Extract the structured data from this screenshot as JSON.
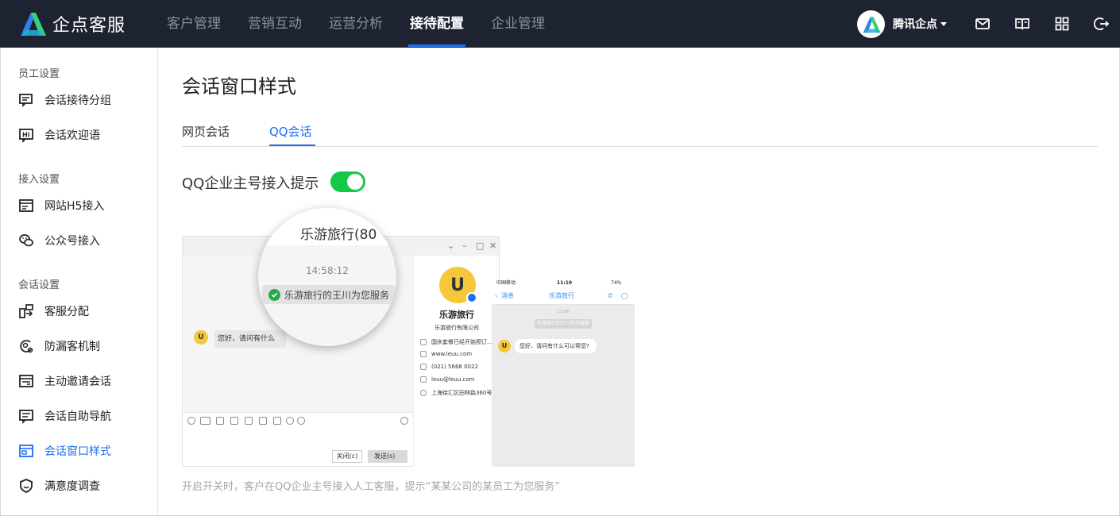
{
  "app": {
    "logo_text": "企点客服",
    "user_name": "腾讯企点"
  },
  "nav": {
    "items": [
      {
        "label": "客户管理"
      },
      {
        "label": "营销互动"
      },
      {
        "label": "运营分析"
      },
      {
        "label": "接待配置",
        "active": true
      },
      {
        "label": "企业管理"
      }
    ]
  },
  "sidebar": {
    "groups": [
      {
        "title": "员工设置",
        "items": [
          {
            "label": "会话接待分组",
            "icon": "chat-group-icon"
          },
          {
            "label": "会话欢迎语",
            "icon": "hi-icon"
          }
        ]
      },
      {
        "title": "接入设置",
        "items": [
          {
            "label": "网站H5接入",
            "icon": "web-icon"
          },
          {
            "label": "公众号接入",
            "icon": "wechat-icon"
          }
        ]
      },
      {
        "title": "会话设置",
        "items": [
          {
            "label": "客服分配",
            "icon": "assign-icon"
          },
          {
            "label": "防漏客机制",
            "icon": "prevent-icon"
          },
          {
            "label": "主动邀请会话",
            "icon": "invite-icon"
          },
          {
            "label": "会话自助导航",
            "icon": "nav-icon"
          },
          {
            "label": "会话窗口样式",
            "icon": "window-icon",
            "active": true
          },
          {
            "label": "满意度调查",
            "icon": "survey-icon"
          }
        ]
      }
    ]
  },
  "main": {
    "title": "会话窗口样式",
    "tabs": [
      {
        "label": "网页会话"
      },
      {
        "label": "QQ会话",
        "active": true
      }
    ],
    "toggle": {
      "label": "QQ企业主号接入提示",
      "on": true
    },
    "hint": "开启开关时，客户在QQ企业主号接入人工客服，提示“某某公司的某员工为您服务”"
  },
  "preview": {
    "bubble_avatar": "U",
    "bubble_text": "您好，请问有什么",
    "close_btn": "关闭(c)",
    "send_btn": "发送(s)",
    "info_name": "乐游旅行",
    "info_company": "乐游旅行有限公司",
    "info_rows": [
      "国庆套餐已经开始预订...",
      "www.leuu.com",
      "(021) 5668 0022",
      "leuu@leuu.com",
      "上海徐汇区田林路360号"
    ],
    "phone_status_left": "中国移动",
    "phone_status_time": "11:10",
    "phone_status_right": "74%",
    "phone_back": "消息",
    "phone_title": "乐游旅行",
    "phone_time": "11:06",
    "phone_pill": "乐游旅行的王川为您服务",
    "phone_bubble": "您好，请问有什么可以帮您?",
    "mag_title": "乐游旅行(80",
    "mag_time": "14:58:12",
    "mag_pill": "乐游旅行的王川为您服务"
  },
  "colors": {
    "topbar": "#1d2330",
    "accent": "#1f6ff0",
    "toggle_on": "#15c84a"
  }
}
